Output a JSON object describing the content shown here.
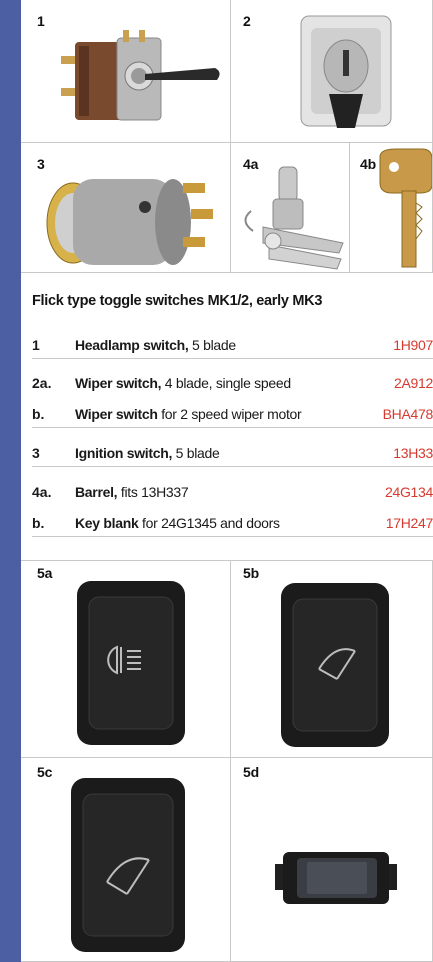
{
  "panels_top": [
    {
      "label": "1"
    },
    {
      "label": "2"
    },
    {
      "label": "3"
    },
    {
      "label": "4a"
    },
    {
      "label": "4b"
    }
  ],
  "section": {
    "heading": "Flick type toggle switches MK1/2, early MK3"
  },
  "rows": [
    {
      "num": "1",
      "name": "Headlamp switch,",
      "desc": " 5 blade",
      "part": "1H907"
    },
    {
      "num": "2a.",
      "name": "Wiper switch,",
      "desc": " 4 blade, single speed",
      "part": "2A912"
    },
    {
      "num": "b.",
      "name": "Wiper switch",
      "desc": " for 2 speed wiper motor",
      "part": "BHA478"
    },
    {
      "num": "3",
      "name": "Ignition switch,",
      "desc": " 5 blade",
      "part": "13H33"
    },
    {
      "num": "4a.",
      "name": "Barrel,",
      "desc": " fits 13H337",
      "part": "24G134"
    },
    {
      "num": "b.",
      "name": "Key blank",
      "desc": " for 24G1345 and doors",
      "part": "17H247"
    }
  ],
  "panels_bottom": [
    {
      "label": "5a"
    },
    {
      "label": "5b"
    },
    {
      "label": "5c"
    },
    {
      "label": "5d"
    }
  ],
  "colors": {
    "sidebar": "#4c5fa3",
    "part_number": "#d63a2f",
    "divider": "#c9c9c9"
  }
}
